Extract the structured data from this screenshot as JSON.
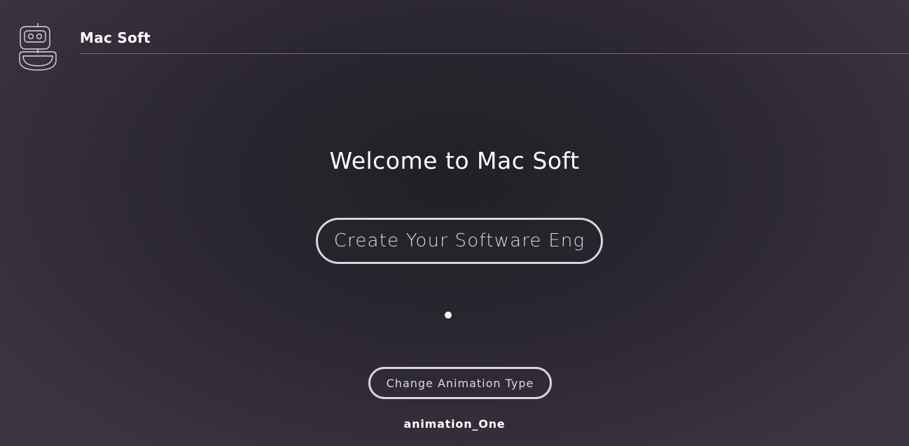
{
  "header": {
    "brand": "Mac Soft",
    "logo_icon": "robot-icon"
  },
  "main": {
    "welcome_title": "Welcome to Mac Soft",
    "typing_button_label": "Create Your Software Eng",
    "change_animation_label": "Change Animation Type",
    "animation_name": "animation_One"
  },
  "colors": {
    "background_center": "#222024",
    "background_edge": "#3a3440",
    "outline": "#d8d6dc",
    "text": "#ffffff"
  }
}
